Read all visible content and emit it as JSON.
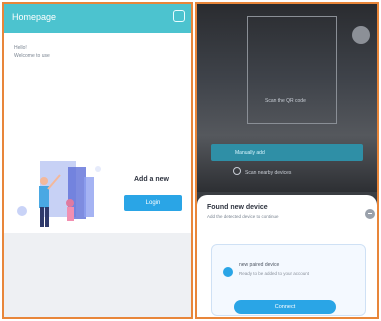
{
  "colors": {
    "accent": "#4cc3cf",
    "primary_button": "#2aa5e6",
    "border": "#e8863a"
  },
  "left": {
    "header": {
      "title": "Homepage"
    },
    "info_line1": "Hello!",
    "info_line2": "Welcome to use",
    "add_card": {
      "title": "Add a new",
      "button_label": "Login"
    }
  },
  "right": {
    "scan_label": "Scan the QR code",
    "manual_bar_text": "Manually add",
    "manual_sub": "Scan nearby devices",
    "sheet": {
      "title": "Found new device",
      "subtitle": "Add the detected device to continue"
    },
    "device": {
      "name": "new paired device",
      "desc": "Ready to be added to your account",
      "connect_label": "Connect"
    }
  }
}
